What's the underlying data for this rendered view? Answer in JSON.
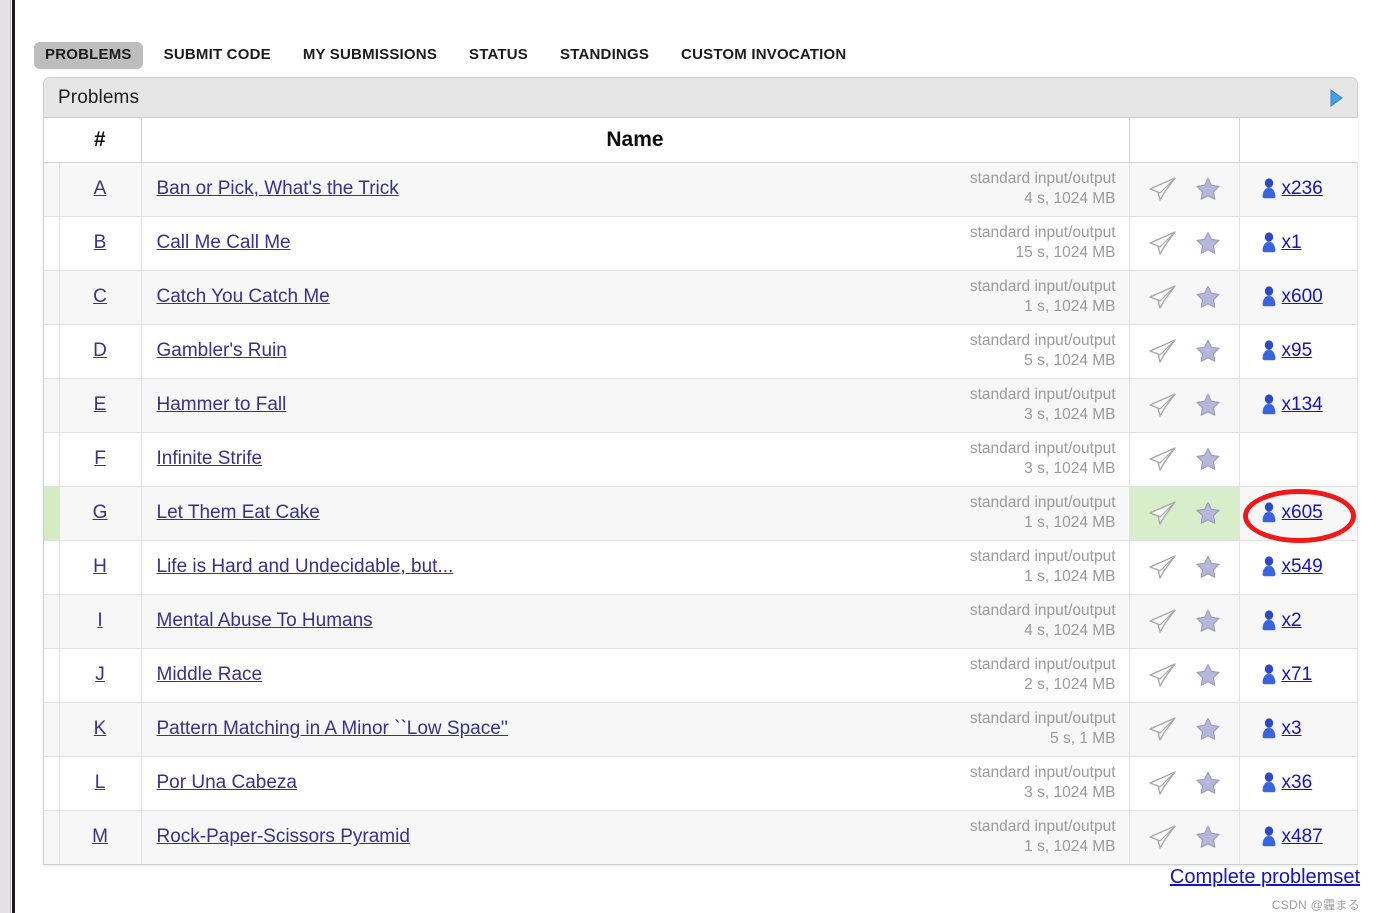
{
  "nav": {
    "items": [
      {
        "label": "PROBLEMS",
        "active": true
      },
      {
        "label": "SUBMIT CODE",
        "active": false
      },
      {
        "label": "MY SUBMISSIONS",
        "active": false
      },
      {
        "label": "STATUS",
        "active": false
      },
      {
        "label": "STANDINGS",
        "active": false
      },
      {
        "label": "CUSTOM INVOCATION",
        "active": false
      }
    ]
  },
  "panel": {
    "title": "Problems",
    "toggle_icon": "triangle-right-icon"
  },
  "table": {
    "headers": {
      "index": "#",
      "name": "Name",
      "icons": "",
      "count": ""
    },
    "rows": [
      {
        "id": "A",
        "name": "Ban or Pick, What's the Trick",
        "io": "standard input/output",
        "limits": "4 s, 1024 MB",
        "count": "x236",
        "solved": false
      },
      {
        "id": "B",
        "name": "Call Me Call Me",
        "io": "standard input/output",
        "limits": "15 s, 1024 MB",
        "count": "x1",
        "solved": false
      },
      {
        "id": "C",
        "name": "Catch You Catch Me",
        "io": "standard input/output",
        "limits": "1 s, 1024 MB",
        "count": "x600",
        "solved": false
      },
      {
        "id": "D",
        "name": "Gambler's Ruin",
        "io": "standard input/output",
        "limits": "5 s, 1024 MB",
        "count": "x95",
        "solved": false
      },
      {
        "id": "E",
        "name": "Hammer to Fall",
        "io": "standard input/output",
        "limits": "3 s, 1024 MB",
        "count": "x134",
        "solved": false
      },
      {
        "id": "F",
        "name": "Infinite Strife",
        "io": "standard input/output",
        "limits": "3 s, 1024 MB",
        "count": "",
        "solved": false
      },
      {
        "id": "G",
        "name": "Let Them Eat Cake",
        "io": "standard input/output",
        "limits": "1 s, 1024 MB",
        "count": "x605",
        "solved": true
      },
      {
        "id": "H",
        "name": "Life is Hard and Undecidable, but...",
        "io": "standard input/output",
        "limits": "1 s, 1024 MB",
        "count": "x549",
        "solved": false
      },
      {
        "id": "I",
        "name": "Mental Abuse To Humans",
        "io": "standard input/output",
        "limits": "4 s, 1024 MB",
        "count": "x2",
        "solved": false
      },
      {
        "id": "J",
        "name": "Middle Race",
        "io": "standard input/output",
        "limits": "2 s, 1024 MB",
        "count": "x71",
        "solved": false
      },
      {
        "id": "K",
        "name": "Pattern Matching in A Minor ``Low Space''",
        "io": "standard input/output",
        "limits": "5 s, 1 MB",
        "count": "x3",
        "solved": false
      },
      {
        "id": "L",
        "name": "Por Una Cabeza",
        "io": "standard input/output",
        "limits": "3 s, 1024 MB",
        "count": "x36",
        "solved": false
      },
      {
        "id": "M",
        "name": "Rock-Paper-Scissors Pyramid",
        "io": "standard input/output",
        "limits": "1 s, 1024 MB",
        "count": "x487",
        "solved": false
      }
    ],
    "row_icons": {
      "submit": "paper-plane-icon",
      "favorite": "star-icon",
      "solvers": "user-icon"
    }
  },
  "footer": {
    "complete_problemset": "Complete problemset",
    "watermark": "CSDN @霾まる"
  },
  "annotation": {
    "type": "red-ellipse-highlight",
    "target": "solved-count-G"
  },
  "colors": {
    "nav_active_bg": "#bdbdbd",
    "panel_header_bg": "#e6e6e6",
    "link": "#3b2f8f",
    "count_link": "#1414c8",
    "solved_row_highlight": "#d3ecc4",
    "limits_text": "#9a9a9a",
    "annotation_red": "#f01818",
    "toggle_blue": "#3c93d8"
  }
}
